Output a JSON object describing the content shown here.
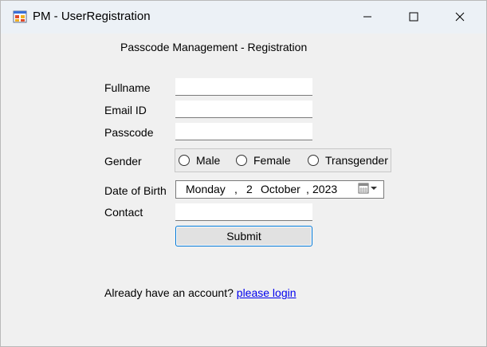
{
  "window": {
    "title": "PM - UserRegistration",
    "icon": "app-form-icon",
    "controls": [
      "minimize-icon",
      "maximize-icon",
      "close-icon"
    ]
  },
  "form": {
    "heading": "Passcode Management - Registration",
    "fullname": {
      "label": "Fullname",
      "value": ""
    },
    "email": {
      "label": "Email ID",
      "value": ""
    },
    "passcode": {
      "label": "Passcode",
      "value": ""
    },
    "gender": {
      "label": "Gender",
      "options": [
        "Male",
        "Female",
        "Transgender"
      ],
      "selected": null
    },
    "dob": {
      "label": "Date of Birth",
      "weekday": "Monday",
      "sep1": ",",
      "day": "2",
      "month": "October",
      "sep2": ",",
      "year": "2023",
      "button_icon": "calendar-dropdown-icon"
    },
    "contact": {
      "label": "Contact",
      "value": ""
    },
    "submit_label": "Submit"
  },
  "footer": {
    "prompt": "Already have an account? ",
    "link": "please login"
  },
  "colors": {
    "titlebar": "#ecf1f6",
    "client_bg": "#f0f0f0",
    "focus_border": "#0078d7",
    "link": "#0000ee"
  }
}
